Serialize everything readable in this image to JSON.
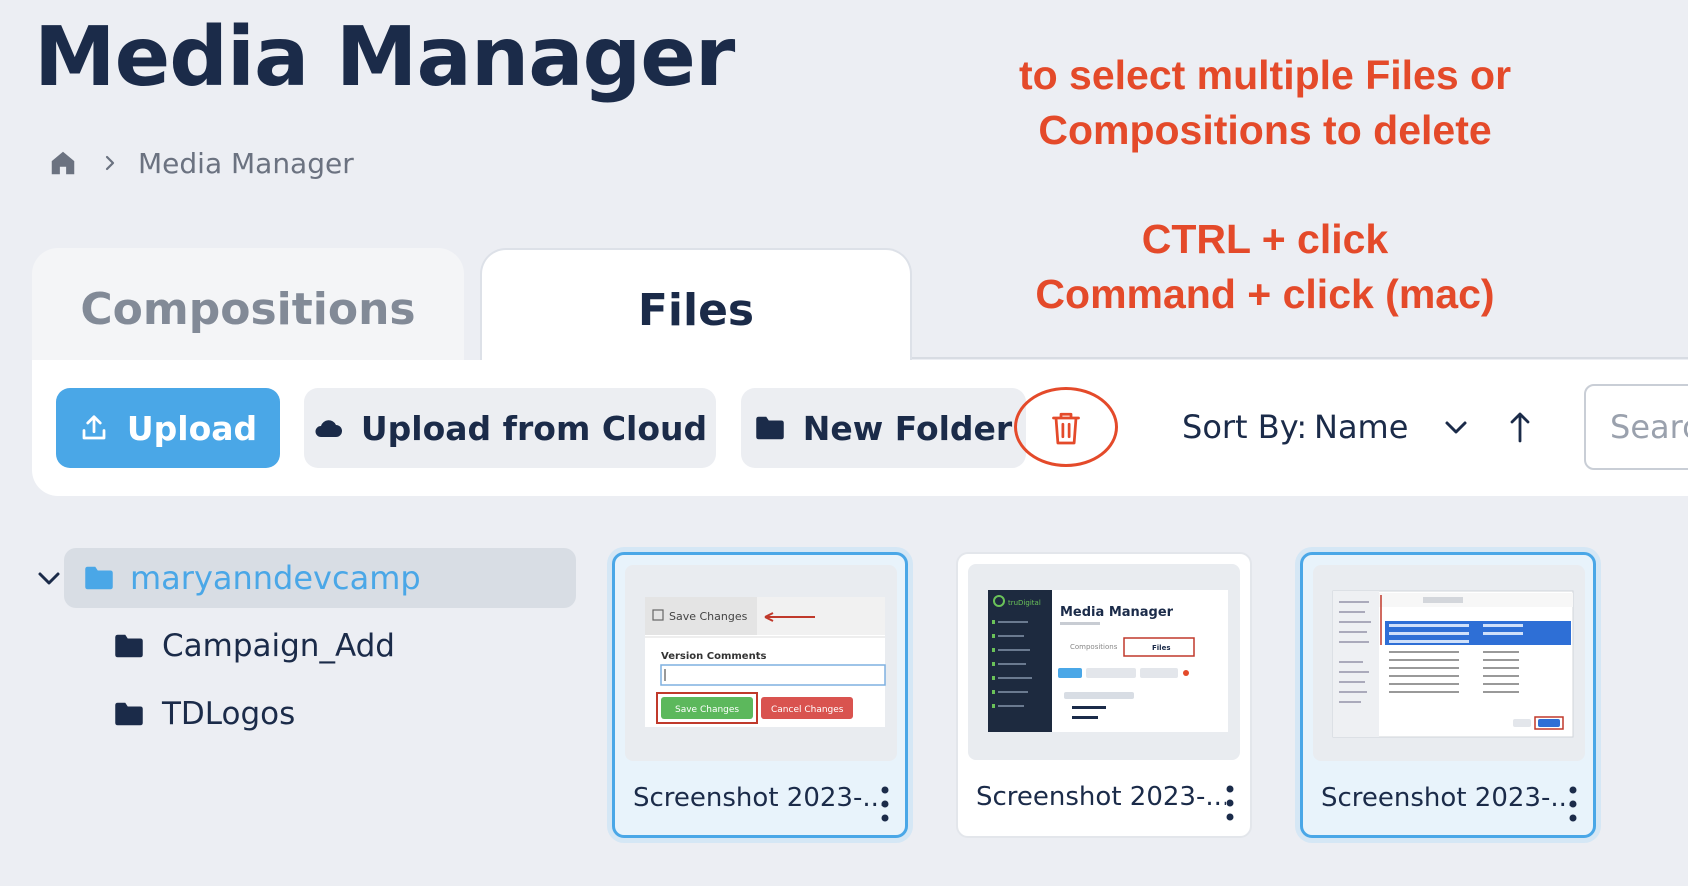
{
  "page": {
    "title": "Media Manager"
  },
  "breadcrumb": {
    "home_icon": "home-icon",
    "separator_icon": "chevron-right-icon",
    "current": "Media Manager"
  },
  "annotations": {
    "line1": "to select multiple Files or",
    "line2": "Compositions to delete",
    "line3": "CTRL + click",
    "line4": "Command + click (mac)",
    "color": "#e44a2a"
  },
  "tabs": [
    {
      "label": "Compositions",
      "active": false
    },
    {
      "label": "Files",
      "active": true
    }
  ],
  "toolbar": {
    "upload_label": "Upload",
    "upload_icon": "upload-icon",
    "cloud_label": "Upload from Cloud",
    "cloud_icon": "cloud-icon",
    "new_folder_label": "New Folder",
    "folder_icon": "folder-icon",
    "delete_icon": "trash-icon",
    "sort_label": "Sort By:",
    "sort_value": "Name",
    "sort_direction_icon": "arrow-up-icon",
    "search_placeholder": "Search"
  },
  "folder_tree": {
    "root": {
      "label": "maryanndevcamp",
      "expanded": true,
      "selected": true
    },
    "children": [
      {
        "label": "Campaign_Add"
      },
      {
        "label": "TDLogos"
      }
    ]
  },
  "files": [
    {
      "name": "Screenshot 2023-...",
      "selected": true,
      "thumb": {
        "save_title": "Save Changes",
        "comments_label": "Version Comments",
        "save_btn": "Save Changes",
        "cancel_btn": "Cancel Changes"
      }
    },
    {
      "name": "Screenshot 2023-...",
      "selected": false,
      "thumb": {
        "brand": "truDigital",
        "title": "Media Manager",
        "tab1": "Compositions",
        "tab2": "Files"
      }
    },
    {
      "name": "Screenshot 2023-...",
      "selected": true,
      "thumb": {}
    }
  ],
  "colors": {
    "accent": "#4aa7e7",
    "navy": "#1b2b49",
    "annotation": "#e44a2a",
    "background": "#eceef3"
  }
}
